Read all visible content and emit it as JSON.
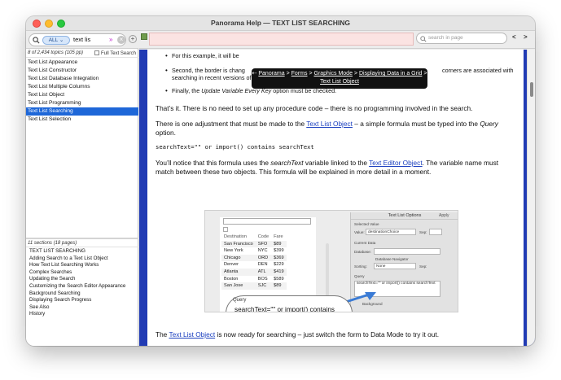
{
  "window": {
    "title": "Panorama Help — TEXT LIST SEARCHING"
  },
  "sidebar": {
    "search": {
      "scope": "ALL",
      "scope_arrow": "⌄",
      "query": "text lis",
      "expand_label": "»",
      "clear_label": "×",
      "add_label": "+"
    },
    "topic_count": "8 of 2,434 topics",
    "topic_pages": "(105 pp)",
    "full_text_search_label": "Full Text Search",
    "topics": [
      "Text List Appearance",
      "Text List Constructor",
      "Text List Database Integration",
      "Text List Multiple Columns",
      "Text List Object",
      "Text List Programming",
      "Text List Searching",
      "Text List Selection"
    ],
    "selected_topic_index": 6,
    "section_count": "11 sections",
    "section_pages": "(18 pages)",
    "sections": [
      "TEXT LIST SEARCHING",
      "Adding Search to a Text List Object",
      "How Text List Searching Works",
      "Complex Searches",
      "Updating the Search",
      "Customizing the Search Editor Appearance",
      "Background Searching",
      "Displaying Search Progress",
      "See Also",
      "History"
    ]
  },
  "toolbar": {
    "page_search_placeholder": "search in page",
    "back_label": "<",
    "forward_label": ">"
  },
  "breadcrumb": {
    "back_arrow": "⇠",
    "items": [
      "Panorama",
      "Forms",
      "Graphics Mode",
      "Displaying Data in a Grid",
      "Text List Object"
    ],
    "separator": ">"
  },
  "doc": {
    "bullet1_text": "For this example, it will be",
    "bullet2_text_a": "Second, the border is chang",
    "bullet2_text_b": "corners are associated with",
    "bullet2_text_c": "searching in recent versions of macOS.",
    "bullet3_text_a": "Finally, the ",
    "bullet3_em": "Update Variable Every Key",
    "bullet3_text_b": " option must be checked.",
    "para1": "That’s it. There is no need to set up any procedure code – there is no programming involved in the search.",
    "para2_a": "There is one adjustment that must be made to the ",
    "para2_link": "Text List Object",
    "para2_b": " – a simple formula must be typed into the ",
    "para2_em": "Query",
    "para2_c": " option.",
    "code": "searchText=\"\" or import() contains searchText",
    "para3_a": "You’ll notice that this formula uses the ",
    "para3_em": "searchText",
    "para3_b": " variable linked to the ",
    "para3_link": "Text Editor Object",
    "para3_c": ". The variable name must match between these two objects. This formula will be explained in more detail in a moment.",
    "para4_a": "The ",
    "para4_link": "Text List Object",
    "para4_b": " is now ready for searching – just switch the form to Data Mode to try it out."
  },
  "figure": {
    "columns": [
      "Destination",
      "Code",
      "Fare"
    ],
    "rows": [
      [
        "San Francisco",
        "SFO",
        "$89"
      ],
      [
        "New York",
        "NYC",
        "$399"
      ],
      [
        "Chicago",
        "ORD",
        "$369"
      ],
      [
        "Denver",
        "DEN",
        "$229"
      ],
      [
        "Atlanta",
        "ATL",
        "$419"
      ],
      [
        "Boston",
        "BOS",
        "$589"
      ],
      [
        "San Jose",
        "SJC",
        "$89"
      ]
    ],
    "inspector": {
      "title": "Text List Options",
      "apply_label": "Apply",
      "selected_value_label": "Selected Value",
      "value_label": "Value:",
      "value_field": "destinationChoice",
      "sep_label": "Sep:",
      "current_data_label": "Current Data",
      "database_label": "Database:",
      "db_navigator_label": "Database Navigator",
      "sorting_label": "Sorting:",
      "sorting_value": "None",
      "query_label": "Query",
      "query_value": "searchText=\"\" or import() contains searchText",
      "background_label": "Background"
    },
    "bubble_label": "Query",
    "bubble_text_1": "searchText=\"\" or import() contains",
    "bubble_text_2": "searchText"
  },
  "bottom_figure": {
    "text": "sea"
  },
  "colors": {
    "selection": "#1e67d8",
    "content_border": "#213bb4",
    "link": "#1a3fbf",
    "pink_field": "#fbe3e2"
  }
}
